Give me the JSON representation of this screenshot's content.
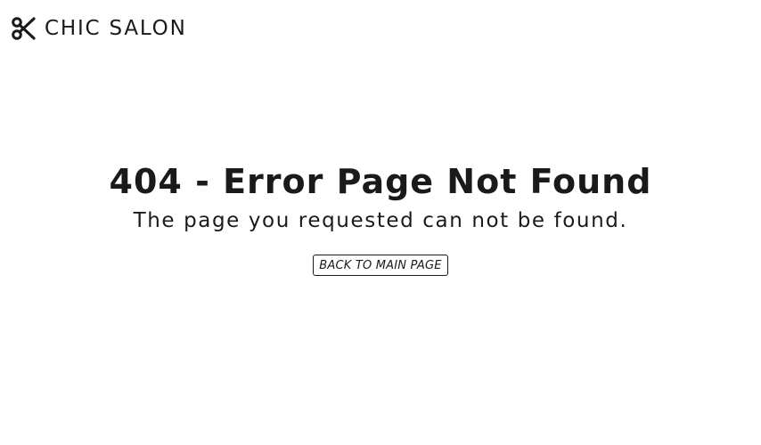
{
  "header": {
    "logo_icon": "scissors-icon",
    "brand_name": "CHIC SALON"
  },
  "error": {
    "title": "404 - Error Page Not Found",
    "message": "The page you requested can not be found.",
    "back_button_label": "BACK TO MAIN PAGE"
  },
  "colors": {
    "background": "#ffffff",
    "text": "#1a1a1a"
  }
}
